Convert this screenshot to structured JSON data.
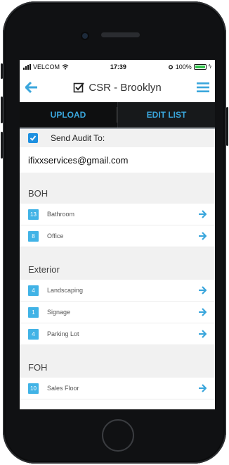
{
  "statusbar": {
    "carrier": "VELCOM",
    "time": "17:39",
    "battery": "100%"
  },
  "header": {
    "title": "CSR - Brooklyn"
  },
  "toolbar": {
    "upload_label": "UPLOAD",
    "edit_label": "EDIT LIST"
  },
  "audit": {
    "label": "Send Audit To:",
    "checked": true
  },
  "email": "ifixxservices@gmail.com",
  "sections": [
    {
      "title": "BOH",
      "items": [
        {
          "count": "13",
          "label": "Bathroom"
        },
        {
          "count": "8",
          "label": "Office"
        }
      ]
    },
    {
      "title": "Exterior",
      "items": [
        {
          "count": "4",
          "label": "Landscaping"
        },
        {
          "count": "1",
          "label": "Signage"
        },
        {
          "count": "4",
          "label": "Parking Lot"
        }
      ]
    },
    {
      "title": "FOH",
      "items": [
        {
          "count": "10",
          "label": "Sales Floor"
        }
      ]
    }
  ],
  "colors": {
    "accent": "#3aa6dc",
    "toolbar_bg": "#0e0f10",
    "badge": "#41b3e6",
    "section_bg": "#f1f1f1",
    "battery_fill": "#33c24d"
  }
}
